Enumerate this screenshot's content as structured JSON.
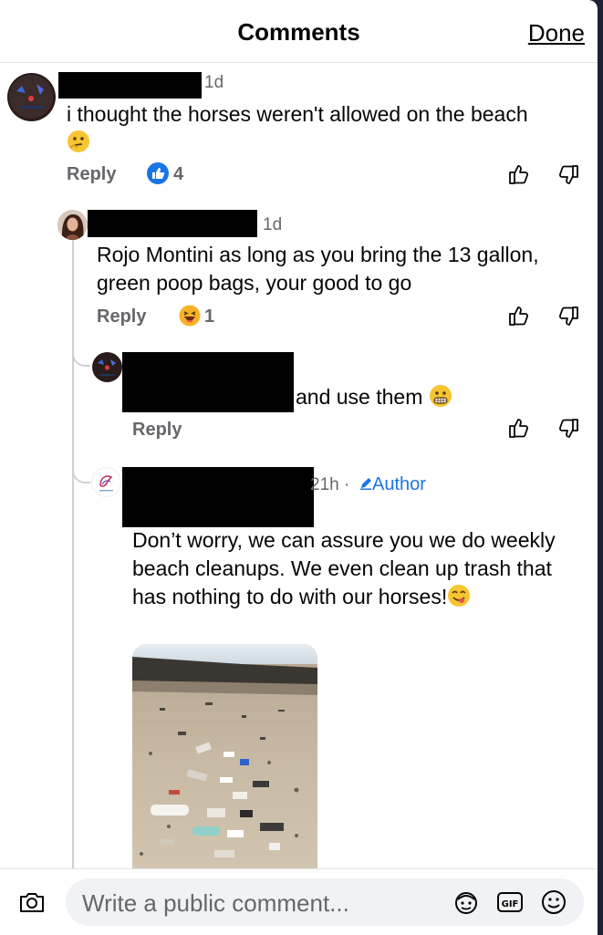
{
  "header": {
    "title": "Comments",
    "done_label": "Done"
  },
  "comments": [
    {
      "time": "1d",
      "text": "i thought the horses weren't allowed on the beach",
      "reply_label": "Reply",
      "reaction_count": "4",
      "reaction_type": "like"
    },
    {
      "time": "1d",
      "text": "Rojo Montini as long as you bring the 13 gallon, green poop bags, your good to go",
      "reply_label": "Reply",
      "reaction_count": "1",
      "reaction_type": "haha"
    },
    {
      "text": "and use them",
      "reply_label": "Reply"
    },
    {
      "time": "21h ·",
      "author_label": "Author",
      "text": "Don’t worry, we can assure you we do weekly beach cleanups. We even clean up trash that has nothing to do with our horses!"
    }
  ],
  "footer": {
    "placeholder": "Write a public comment..."
  },
  "colors": {
    "accent": "#1b74e4",
    "meta_text": "#65676b",
    "input_bg": "#f0f2f5"
  }
}
